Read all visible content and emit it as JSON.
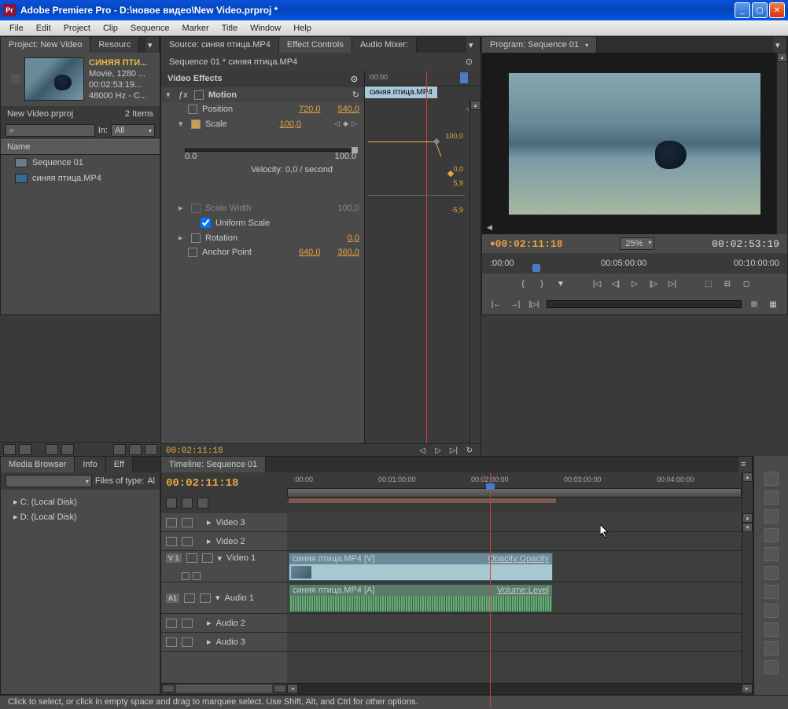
{
  "titlebar": {
    "icon_label": "Pr",
    "text": "Adobe Premiere Pro - D:\\новое видео\\New Video.prproj *"
  },
  "menu": [
    "File",
    "Edit",
    "Project",
    "Clip",
    "Sequence",
    "Marker",
    "Title",
    "Window",
    "Help"
  ],
  "project": {
    "tab": "Project: New Video",
    "tab2": "Resourc",
    "clip_name": "СИНЯЯ ПТИ...",
    "meta1": "Movie, 1280 ...",
    "meta2": "00:02:53:19...",
    "meta3": "48000 Hz - C...",
    "file": "New Video.prproj",
    "items": "2 Items",
    "in_label": "In:",
    "in_value": "All",
    "col_name": "Name",
    "rows": [
      {
        "icon": "seq",
        "label": "Sequence 01"
      },
      {
        "icon": "clip",
        "label": "синяя птица.MP4"
      }
    ]
  },
  "source_tabs": {
    "source": "Source: синяя птица.MP4",
    "fx": "Effect Controls",
    "mixer": "Audio Mixer:"
  },
  "fx": {
    "breadcrumb": "Sequence 01 * синяя птица.MP4",
    "section": "Video Effects",
    "motion": "Motion",
    "position_label": "Position",
    "position_x": "720,0",
    "position_y": "540,0",
    "scale_label": "Scale",
    "scale_val": "100,0",
    "graph_min": "0.0",
    "graph_max": "100.0",
    "graph_top": "100,0",
    "vel_zero": "0,0",
    "vel_pos": "5,9",
    "velocity": "Velocity: 0,0 / second",
    "vel_neg": "-5,9",
    "scale_width_label": "Scale Width",
    "scale_width_val": "100,0",
    "uniform": "Uniform Scale",
    "rotation_label": "Rotation",
    "rotation_val": "0,0",
    "anchor_label": "Anchor Point",
    "anchor_x": "640,0",
    "anchor_y": "360,0",
    "timecode": "00:02:11:18",
    "mini_time": ":00:00",
    "mini_clip": "синяя птица.MP4"
  },
  "program": {
    "tab": "Program: Sequence 01",
    "tc_current": "00:02:11:18",
    "zoom": "25%",
    "tc_duration": "00:02:53:19",
    "ruler": [
      ":00:00",
      "00:05:00:00",
      "00:10:00:00"
    ]
  },
  "media_browser": {
    "tabs": [
      "Media Browser",
      "Info",
      "Eff"
    ],
    "filter_label": "Files of type:",
    "filter_value": "Al",
    "drives": [
      "C: (Local Disk)",
      "D: (Local Disk)"
    ]
  },
  "timeline": {
    "tab": "Timeline: Sequence 01",
    "timecode": "00:02:11:18",
    "ruler": [
      ":00:00",
      "00:01:00:00",
      "00:02:00:00",
      "00:03:00:00",
      "00:04:00:00"
    ],
    "tracks": {
      "v3": "Video 3",
      "v2": "Video 2",
      "v1": "Video 1",
      "v1_badge": "V 1",
      "a1": "Audio 1",
      "a1_badge": "A1",
      "a2": "Audio 2",
      "a3": "Audio 3"
    },
    "clip_v": "синяя птица.MP4 [V]",
    "clip_v_fx": "Opacity:Opacity",
    "clip_a": "синяя птица.MP4 [A]",
    "clip_a_fx": "Volume:Level"
  },
  "status": "Click to select, or click in empty space and drag to marquee select. Use Shift, Alt, and Ctrl for other options."
}
